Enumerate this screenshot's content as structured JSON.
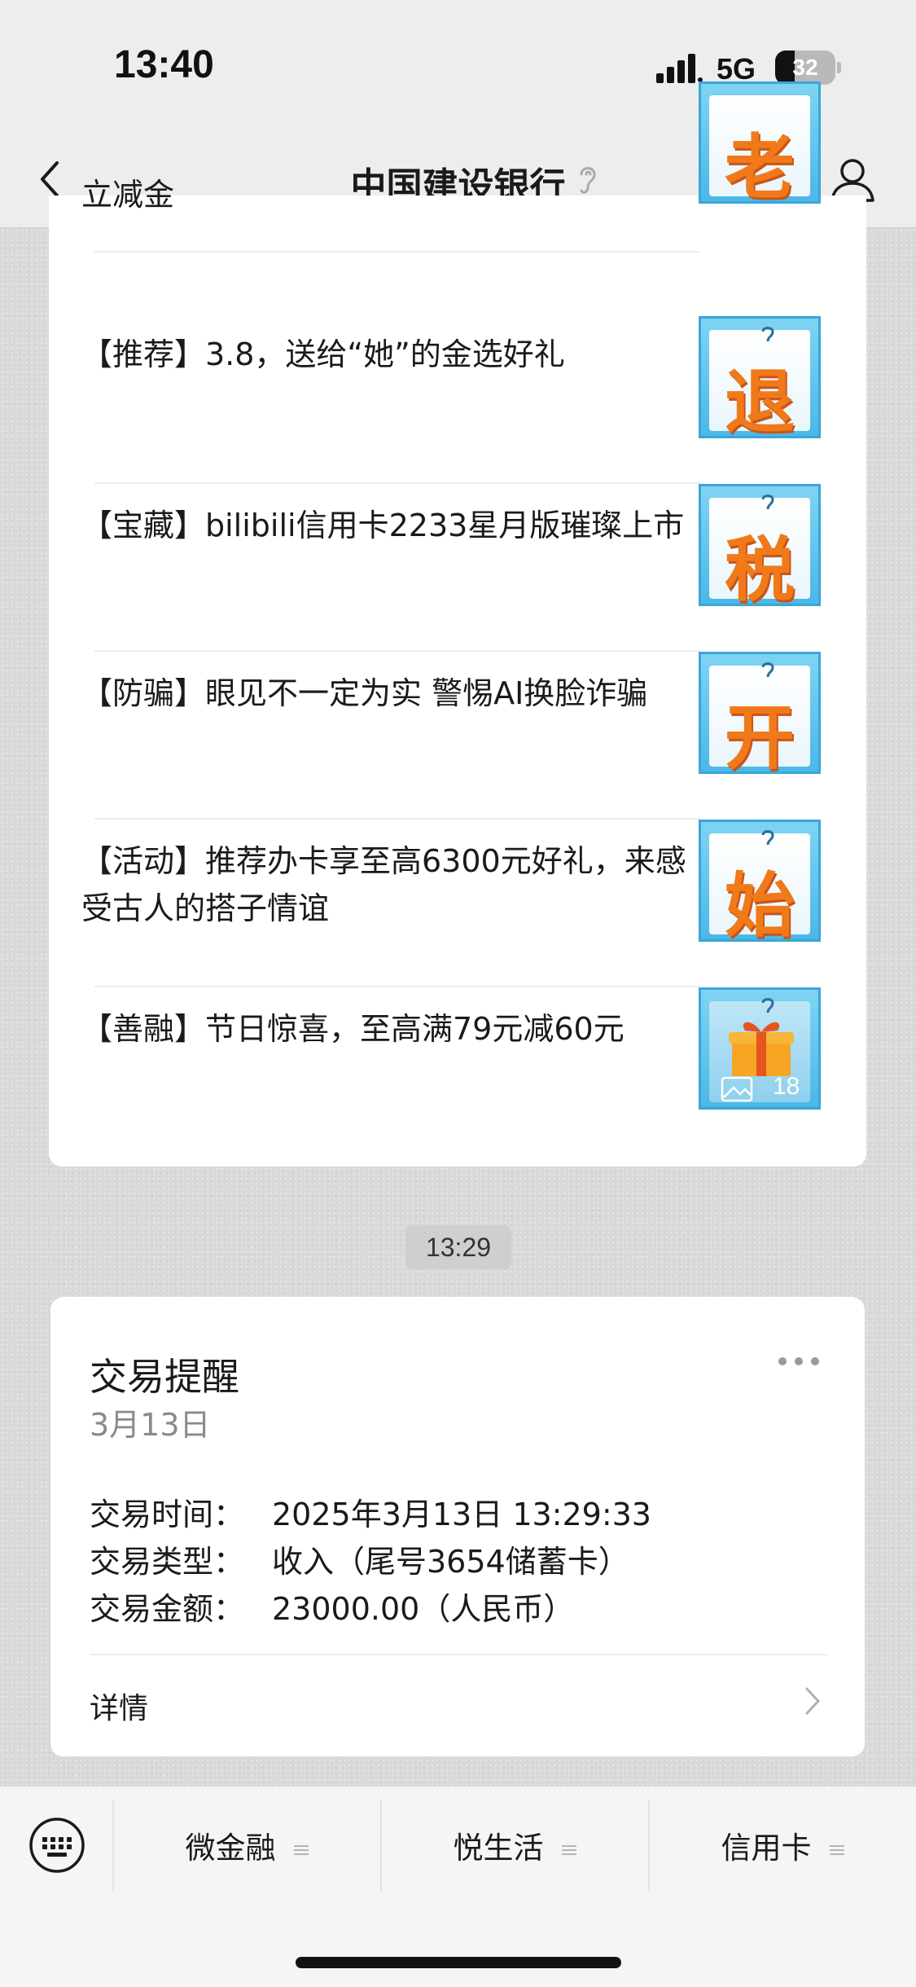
{
  "status_bar": {
    "time": "13:40",
    "network": "5G",
    "battery": "32",
    "battery_level": 0.32
  },
  "header": {
    "title": "中国建设银行"
  },
  "articles": [
    {
      "title": "立减金",
      "thumb_char": "老"
    },
    {
      "title": "【推荐】3.8，送给“她”的金选好礼",
      "thumb_char": "退"
    },
    {
      "title": "【宝藏】bilibili信用卡2233星月版璀璨上市",
      "thumb_char": "税"
    },
    {
      "title": "【防骗】眼见不一定为实 警惕AI换脸诈骗",
      "thumb_char": "开"
    },
    {
      "title": "【活动】推荐办卡享至高6300元好礼，来感受古人的搭子情谊",
      "thumb_char": "始"
    },
    {
      "title": "【善融】节日惊喜，至高满79元减60元",
      "thumb_image_count": "18"
    }
  ],
  "timestamp": "13:29",
  "transaction": {
    "title": "交易提醒",
    "date": "3月13日",
    "rows": [
      {
        "label": "交易时间：",
        "value": "2025年3月13日 13:29:33"
      },
      {
        "label": "交易类型：",
        "value": "收入（尾号3654储蓄卡）"
      },
      {
        "label": "交易金额：",
        "value": "23000.00（人民币）"
      }
    ],
    "detail_label": "详情"
  },
  "menu": {
    "items": [
      "微金融",
      "悦生活",
      "信用卡"
    ]
  },
  "colors": {
    "accent_orange": "#f07a1a",
    "thumb_blue": "#4ab8e8"
  }
}
